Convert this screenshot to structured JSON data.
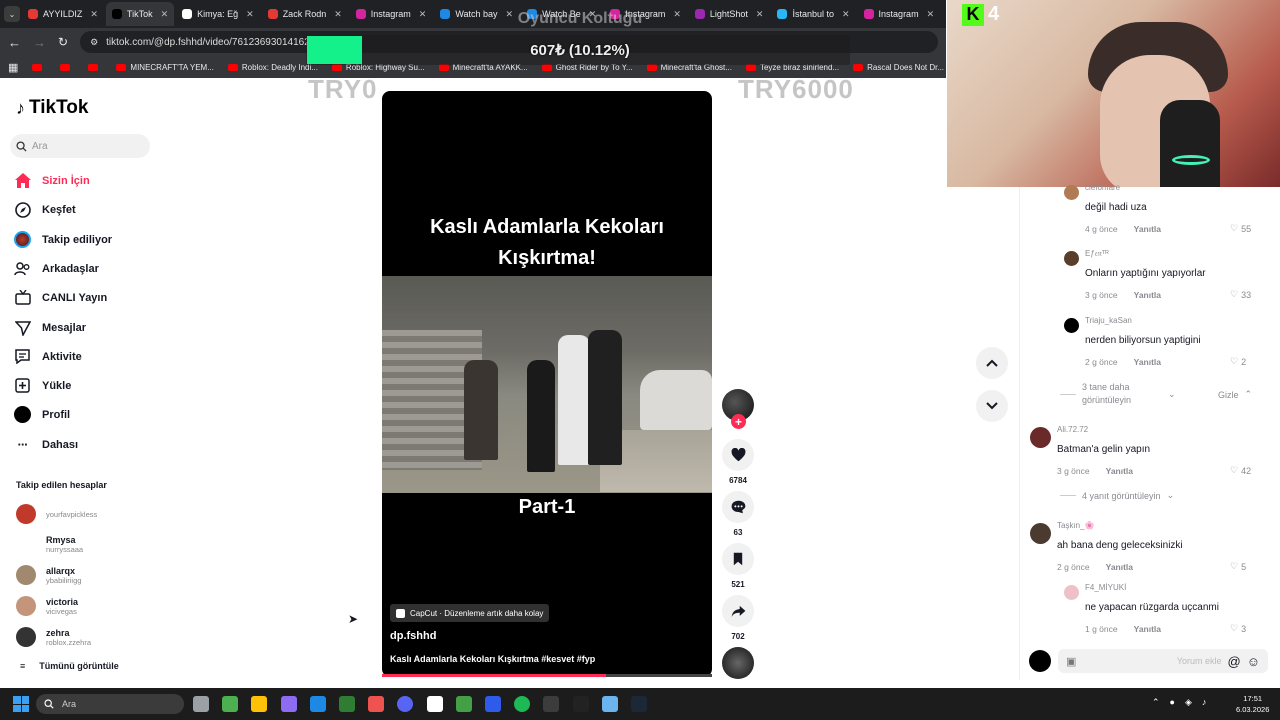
{
  "browser": {
    "tabs": [
      {
        "label": "AYYILDIZ",
        "color": "#e53935"
      },
      {
        "label": "TikTok",
        "color": "#000000",
        "active": true
      },
      {
        "label": "Kimya: Eğ",
        "color": "#ffffff"
      },
      {
        "label": "Zack Rodn",
        "color": "#e53935"
      },
      {
        "label": "Instagram",
        "color": "#d6249f"
      },
      {
        "label": "Watch bay",
        "color": "#1e88e5"
      },
      {
        "label": "Watch Be",
        "color": "#1e88e5"
      },
      {
        "label": "Instagram",
        "color": "#d6249f"
      },
      {
        "label": "LightShot",
        "color": "#9c27b0"
      },
      {
        "label": "İstanbul to",
        "color": "#29b6f6"
      },
      {
        "label": "Instagram",
        "color": "#d6249f"
      },
      {
        "label": "Ro",
        "color": "#e53935"
      }
    ],
    "url": "tiktok.com/@dp.fshhd/video/7612369301416201",
    "bookmarks": [
      "",
      "",
      "",
      "MINECRAFT'TA YEM...",
      "Roblox: Deadly Indi...",
      "Roblox: Highway Su...",
      "Minecraft'ta AYAKK...",
      "Ghost Rider by To Y...",
      "Minecraft'ta Ghost...",
      "Teyze biraz sinirlend...",
      "Rascal Does Not Dr...",
      ""
    ]
  },
  "overlay": {
    "goal_title": "Oyuncu Koltuğu",
    "goal_amount": "607₺ (10.12%)",
    "goal_percent": 10.12,
    "goal_start": "TRY0",
    "goal_end": "TRY6000",
    "goal_color": "#14f08a",
    "kick_viewers": "4"
  },
  "tiktok": {
    "logo": "TikTok",
    "search_placeholder": "Ara",
    "nav": [
      {
        "label": "Sizin İçin",
        "icon": "home-icon",
        "active": true
      },
      {
        "label": "Keşfet",
        "icon": "compass-icon"
      },
      {
        "label": "Takip ediliyor",
        "icon": "following-avatar-icon"
      },
      {
        "label": "Arkadaşlar",
        "icon": "friends-icon"
      },
      {
        "label": "CANLI Yayın",
        "icon": "live-icon"
      },
      {
        "label": "Mesajlar",
        "icon": "send-icon"
      },
      {
        "label": "Aktivite",
        "icon": "activity-icon"
      },
      {
        "label": "Yükle",
        "icon": "upload-icon"
      },
      {
        "label": "Profil",
        "icon": "profile-icon"
      },
      {
        "label": "Dahası",
        "icon": "more-icon"
      }
    ],
    "followed_header": "Takip edilen hesaplar",
    "followed": [
      {
        "name": "",
        "username": "yourfavpickless",
        "color": "#c0392b"
      },
      {
        "name": "Rmysa",
        "username": "nurryssaaa",
        "color": "#ffffff"
      },
      {
        "name": "allarqx",
        "username": "ybabiliriigg",
        "color": "#a0896e"
      },
      {
        "name": "victoria",
        "username": "vicivegas",
        "color": "#c4957a"
      },
      {
        "name": "zehra",
        "username": "roblox.zzehra",
        "color": "#333333"
      }
    ],
    "see_all": "Tümünü görüntüle"
  },
  "video": {
    "title_line1": "Kaslı Adamlarla Kekoları",
    "title_line2": "Kışkırtma!",
    "part": "Part-1",
    "capcut": "CapCut · Düzenleme artık daha kolay",
    "author": "dp.fshhd",
    "caption": "Kaslı Adamlarla Kekoları Kışkırtma #kesvet #fyp",
    "progress": 0.68,
    "likes": "6784",
    "comments": "63",
    "saves": "521",
    "shares": "702"
  },
  "comments": [
    {
      "user": "ciefomare",
      "text": "değil hadi uza",
      "time": "4 g önce",
      "reply": "Yanıtla",
      "likes": "55",
      "indent": true,
      "color": "#b07a55"
    },
    {
      "user": "Eƒ𝔢𝔫ᵀᴿ",
      "text": "Onların yaptığını yapıyorlar",
      "time": "3 g önce",
      "reply": "Yanıtla",
      "likes": "33",
      "indent": true,
      "color": "#5a3d2b"
    },
    {
      "user": "Triaju_kaSan",
      "text": "nerden biliyorsun yaptigini",
      "time": "2 g önce",
      "reply": "Yanıtla",
      "likes": "2",
      "indent": true,
      "color": "#000000"
    },
    {
      "user": "Ali.72.72",
      "text": "Batman'a gelin yapın",
      "time": "3 g önce",
      "reply": "Yanıtla",
      "likes": "42",
      "indent": false,
      "color": "#6b2a2a"
    },
    {
      "user": "Taşkın_🌸",
      "text": "ah bana deng geleceksinizki",
      "time": "2 g önce",
      "reply": "Yanıtla",
      "likes": "5",
      "indent": false,
      "color": "#4a3a30"
    },
    {
      "user": "F4_MİYUKİ",
      "text": "ne yapacan rüzgarda uçcanmi",
      "time": "1 g önce",
      "reply": "Yanıtla",
      "likes": "3",
      "indent": true,
      "color": "#f0c0c8"
    }
  ],
  "comment_more_1": "3 tane daha görüntüleyin",
  "comment_hide": "Gizle",
  "comment_more_2": "4 yanıt görüntüleyin",
  "comment_input_placeholder": "Yorum ekle",
  "taskbar": {
    "search": "Ara",
    "time": "17:51",
    "date": "6.03.2026"
  }
}
